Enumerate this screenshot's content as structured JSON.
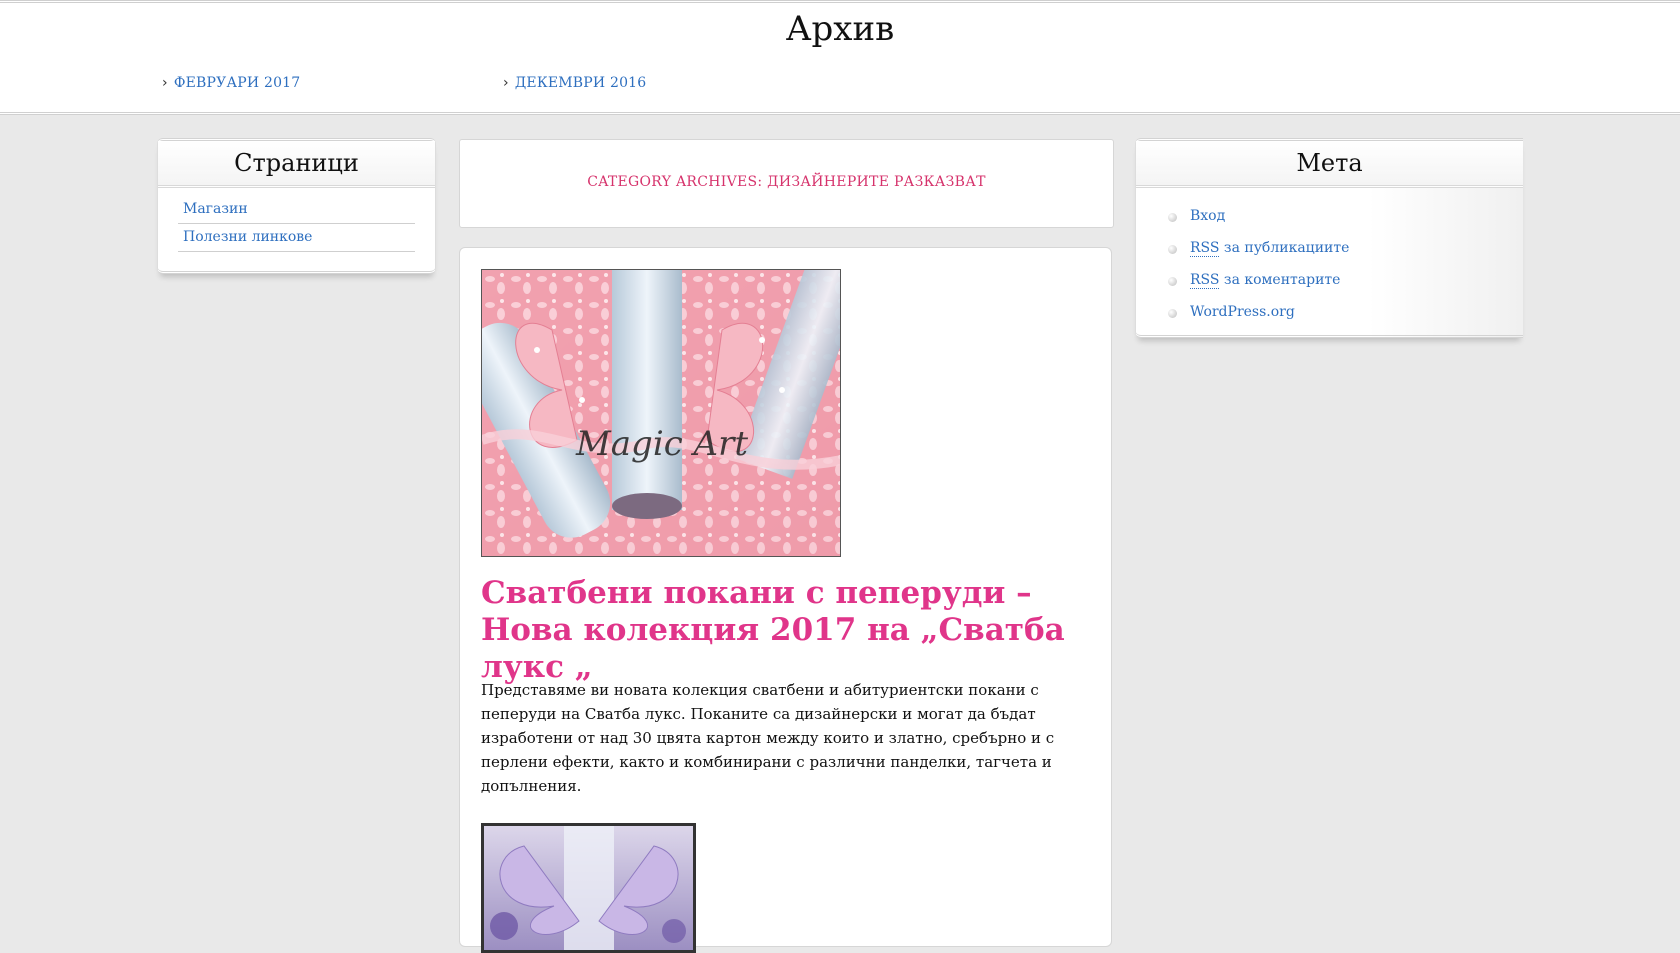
{
  "archive": {
    "title": "Архив",
    "links": [
      {
        "label": "Февруари 2017"
      },
      {
        "label": "Декември 2016"
      }
    ]
  },
  "pages_widget": {
    "title": "Страници",
    "items": [
      {
        "label": "Магазин"
      },
      {
        "label": "Полезни линкове"
      }
    ]
  },
  "category": {
    "heading": "CATEGORY ARCHIVES: ДИЗАЙНЕРИТЕ РАЗКАЗВАТ"
  },
  "post": {
    "title": "Сватбени покани с пеперуди – Нова колекция 2017 на „Сватба лукс „",
    "excerpt": "Представяме ви новата колекция сватбени и абитуриентски покани с пеперуди на Сватба лукс. Поканите са дизайнерски и могат да бъдат изработени от над 30 цвята картон между които и златно, сребърно и с перлени ефекти, както и комбинирани с различни панделки, тагчета и допълнения.",
    "image1_watermark": "Magic Art"
  },
  "meta_widget": {
    "title": "Мета",
    "items": [
      {
        "label": "Вход"
      },
      {
        "abbr": "RSS",
        "label": " за публикациите"
      },
      {
        "abbr": "RSS",
        "label": " за коментарите"
      },
      {
        "label": "WordPress.org"
      }
    ]
  },
  "colors": {
    "link": "#2e6fbf",
    "accent_pink": "#e0358a",
    "category_pink": "#d6336c",
    "background": "#e9e9e9"
  },
  "icons": {
    "archive_bullet": "chevron-right-icon",
    "meta_bullet": "bullet-dot-icon"
  }
}
